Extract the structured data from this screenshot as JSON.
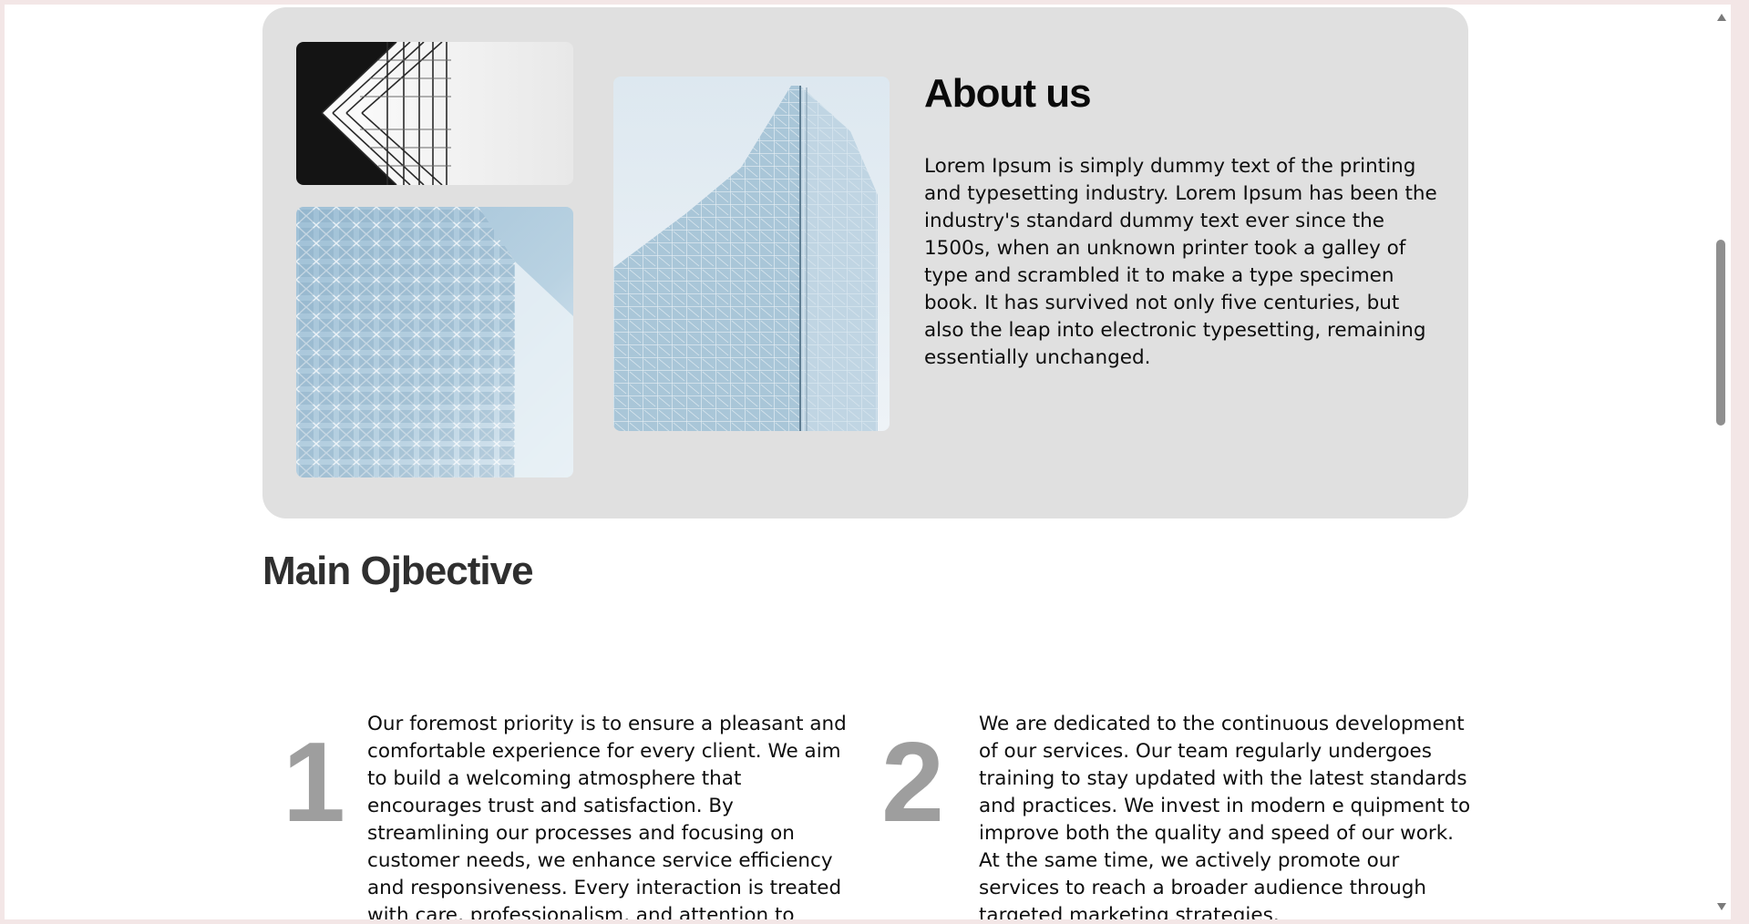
{
  "about": {
    "title": "About us",
    "text": "Lorem Ipsum is simply dummy text of the printing and typesetting industry. Lorem Ipsum has been the industry's standard dummy text ever since the 1500s, when an unknown printer took a galley of type and scrambled it to make a type specimen book. It has survived not only five centuries, but also the leap into electronic typesetting, remaining essentially unchanged.",
    "images": [
      "building-glass-facade-black-white",
      "building-glass-facade-blue",
      "glass-skyscraper-corner"
    ]
  },
  "objective": {
    "title": "Main Ojbective",
    "items": [
      {
        "number": "1",
        "text": "Our foremost priority is to ensure a pleasant and comfortable experience for every client. We aim to build a welcoming atmosphere that encourages trust and satisfaction. By streamlining our processes and focusing on customer needs, we enhance service efficiency and responsiveness. Every interaction is treated with care, professionalism, and attention to detail."
      },
      {
        "number": "2",
        "text": "We are dedicated to the continuous development of our services. Our team regularly undergoes training to stay updated with the latest standards and practices. We invest in modern e quipment to improve both the quality and speed of our work. At the same time, we actively promote our services to reach a broader audience through targeted marketing strategies."
      }
    ]
  },
  "colors": {
    "card_background": "#e0e0e0",
    "number_gray": "#9e9e9e",
    "heading_dark": "#2f2f2f"
  },
  "icons": [
    "scroll-up-arrow-icon",
    "scroll-down-arrow-icon"
  ]
}
